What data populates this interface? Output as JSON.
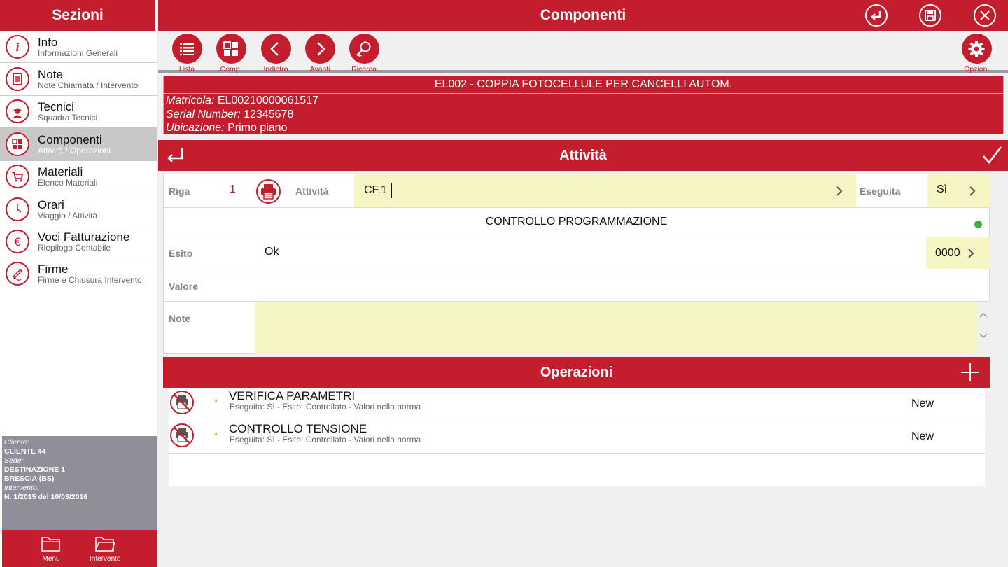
{
  "sidebar": {
    "title": "Sezioni",
    "items": [
      {
        "label": "Info",
        "sub": "Informazioni Generali",
        "icon": "info-icon"
      },
      {
        "label": "Note",
        "sub": "Note Chiamata / Intervento",
        "icon": "notes-icon"
      },
      {
        "label": "Tecnici",
        "sub": "Squadra Tecnici",
        "icon": "technician-icon"
      },
      {
        "label": "Componenti",
        "sub": "Attività / Operazioni",
        "icon": "components-icon",
        "active": true
      },
      {
        "label": "Materiali",
        "sub": "Elenco Materiali",
        "icon": "cart-icon"
      },
      {
        "label": "Orari",
        "sub": "Viaggio / Attività",
        "icon": "clock-icon"
      },
      {
        "label": "Voci Fatturazione",
        "sub": "Riepilogo Contabile",
        "icon": "euro-icon"
      },
      {
        "label": "Firme",
        "sub": "Firme e Chiusura Intervento",
        "icon": "signature-icon"
      }
    ],
    "client": {
      "cliente_label": "Cliente:",
      "cliente": "CLIENTE  44",
      "sede_label": "Sede:",
      "sede_line1": "DESTINAZIONE  1",
      "sede_line2": "BRESCIA (BS)",
      "intervento_label": "Intervento:",
      "intervento": "N. 1/2015 del 10/03/2016"
    },
    "footer": {
      "menu_label": "Menu",
      "intervento_label": "Intervento"
    }
  },
  "topbar": {
    "title": "Componenti"
  },
  "toolbar": {
    "lista": "Lista",
    "comp": "Comp.",
    "indietro": "Indietro",
    "avanti": "Avanti",
    "ricerca": "Ricerca",
    "opzioni": "Opzioni"
  },
  "component": {
    "title": "EL002 - COPPIA FOTOCELLULE PER CANCELLI AUTOM.",
    "matricola_label": "Matricola:",
    "matricola": "EL00210000061517",
    "serial_label": "Serial Number:",
    "serial": "12345678",
    "ubicazione_label": "Ubicazione:",
    "ubicazione": "Primo piano"
  },
  "attivita": {
    "header": "Attività",
    "riga_label": "Riga",
    "riga": "1",
    "attivita_label": "Attività",
    "attivita_value": "CF.1",
    "eseguita_label": "Eseguita",
    "eseguita_value": "Sì",
    "description": "CONTROLLO PROGRAMMAZIONE",
    "esito_label": "Esito",
    "esito_value": "Ok",
    "esito_code": "0000",
    "valore_label": "Valore",
    "note_label": "Note"
  },
  "operazioni": {
    "header": "Operazioni",
    "items": [
      {
        "title": "VERIFICA PARAMETRI",
        "sub": "Eseguita: Sì - Esito: Controllato - Valori nella norma",
        "status": "New",
        "star": "*"
      },
      {
        "title": "CONTROLLO TENSIONE",
        "sub": "Eseguita: Sì - Esito: Controllato - Valori nella norma",
        "status": "New",
        "star": "*"
      }
    ]
  },
  "colors": {
    "accent": "#c41e2e",
    "field_bg": "#f8f5c4",
    "status_dot": "#3cb043"
  }
}
